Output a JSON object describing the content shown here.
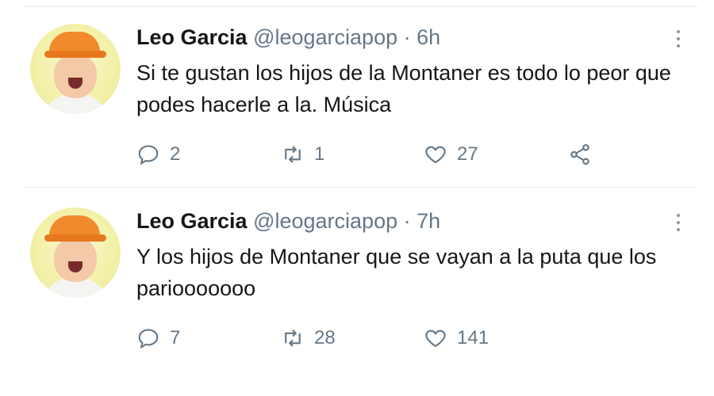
{
  "tweets": [
    {
      "name": "Leo Garcia",
      "handle": "@leogarciapop",
      "separator": "·",
      "time": "6h",
      "text": "Si te gustan los hijos de la Montaner es todo lo peor que podes hacerle a la. Música",
      "replies": "2",
      "retweets": "1",
      "likes": "27",
      "show_share": true
    },
    {
      "name": "Leo Garcia",
      "handle": "@leogarciapop",
      "separator": "·",
      "time": "7h",
      "text": "Y los hijos de Montaner que se vayan a la puta que los pariooooooo",
      "replies": "7",
      "retweets": "28",
      "likes": "141",
      "show_share": false
    }
  ],
  "icons": {
    "reply": "reply-icon",
    "retweet": "retweet-icon",
    "like": "heart-icon",
    "share": "share-icon",
    "more": "more-icon"
  },
  "colors": {
    "text": "#14171a",
    "muted": "#657786",
    "divider": "#e6ecf0"
  }
}
